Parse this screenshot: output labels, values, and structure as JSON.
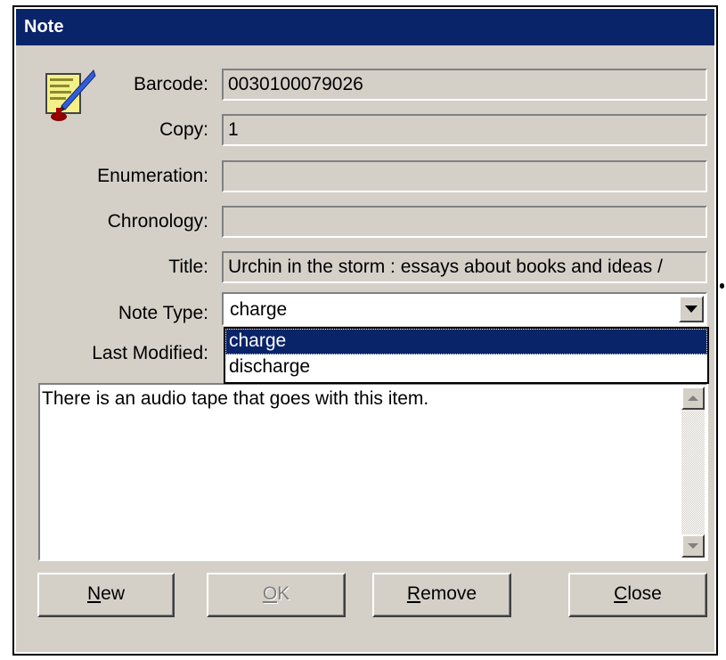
{
  "window": {
    "title": "Note"
  },
  "icons": {
    "app": "note-pen-icon",
    "dropdown": "chevron-down-icon",
    "scroll_up": "scroll-up-arrow-icon",
    "scroll_down": "scroll-down-arrow-icon"
  },
  "fields": {
    "barcode": {
      "label": "Barcode:",
      "value": "0030100079026"
    },
    "copy": {
      "label": "Copy:",
      "value": "1"
    },
    "enumeration": {
      "label": "Enumeration:",
      "value": ""
    },
    "chronology": {
      "label": "Chronology:",
      "value": ""
    },
    "title": {
      "label": "Title:",
      "value": "Urchin in the storm : essays about books and ideas /"
    },
    "note_type": {
      "label": "Note Type:",
      "value": "charge"
    },
    "last_modified": {
      "label": "Last Modified:"
    }
  },
  "note_type_options": [
    "charge",
    "discharge"
  ],
  "note_text": "There is an audio tape that goes with this item.",
  "buttons": {
    "new": {
      "mnemonic": "N",
      "rest": "ew"
    },
    "ok": {
      "mnemonic": "O",
      "rest": "K"
    },
    "remove": {
      "mnemonic": "R",
      "rest": "emove"
    },
    "close": {
      "mnemonic": "C",
      "rest": "lose"
    }
  },
  "colors": {
    "title_bar": "#0a246a",
    "dialog_bg": "#d4d0c8",
    "selection": "#0a246a"
  }
}
